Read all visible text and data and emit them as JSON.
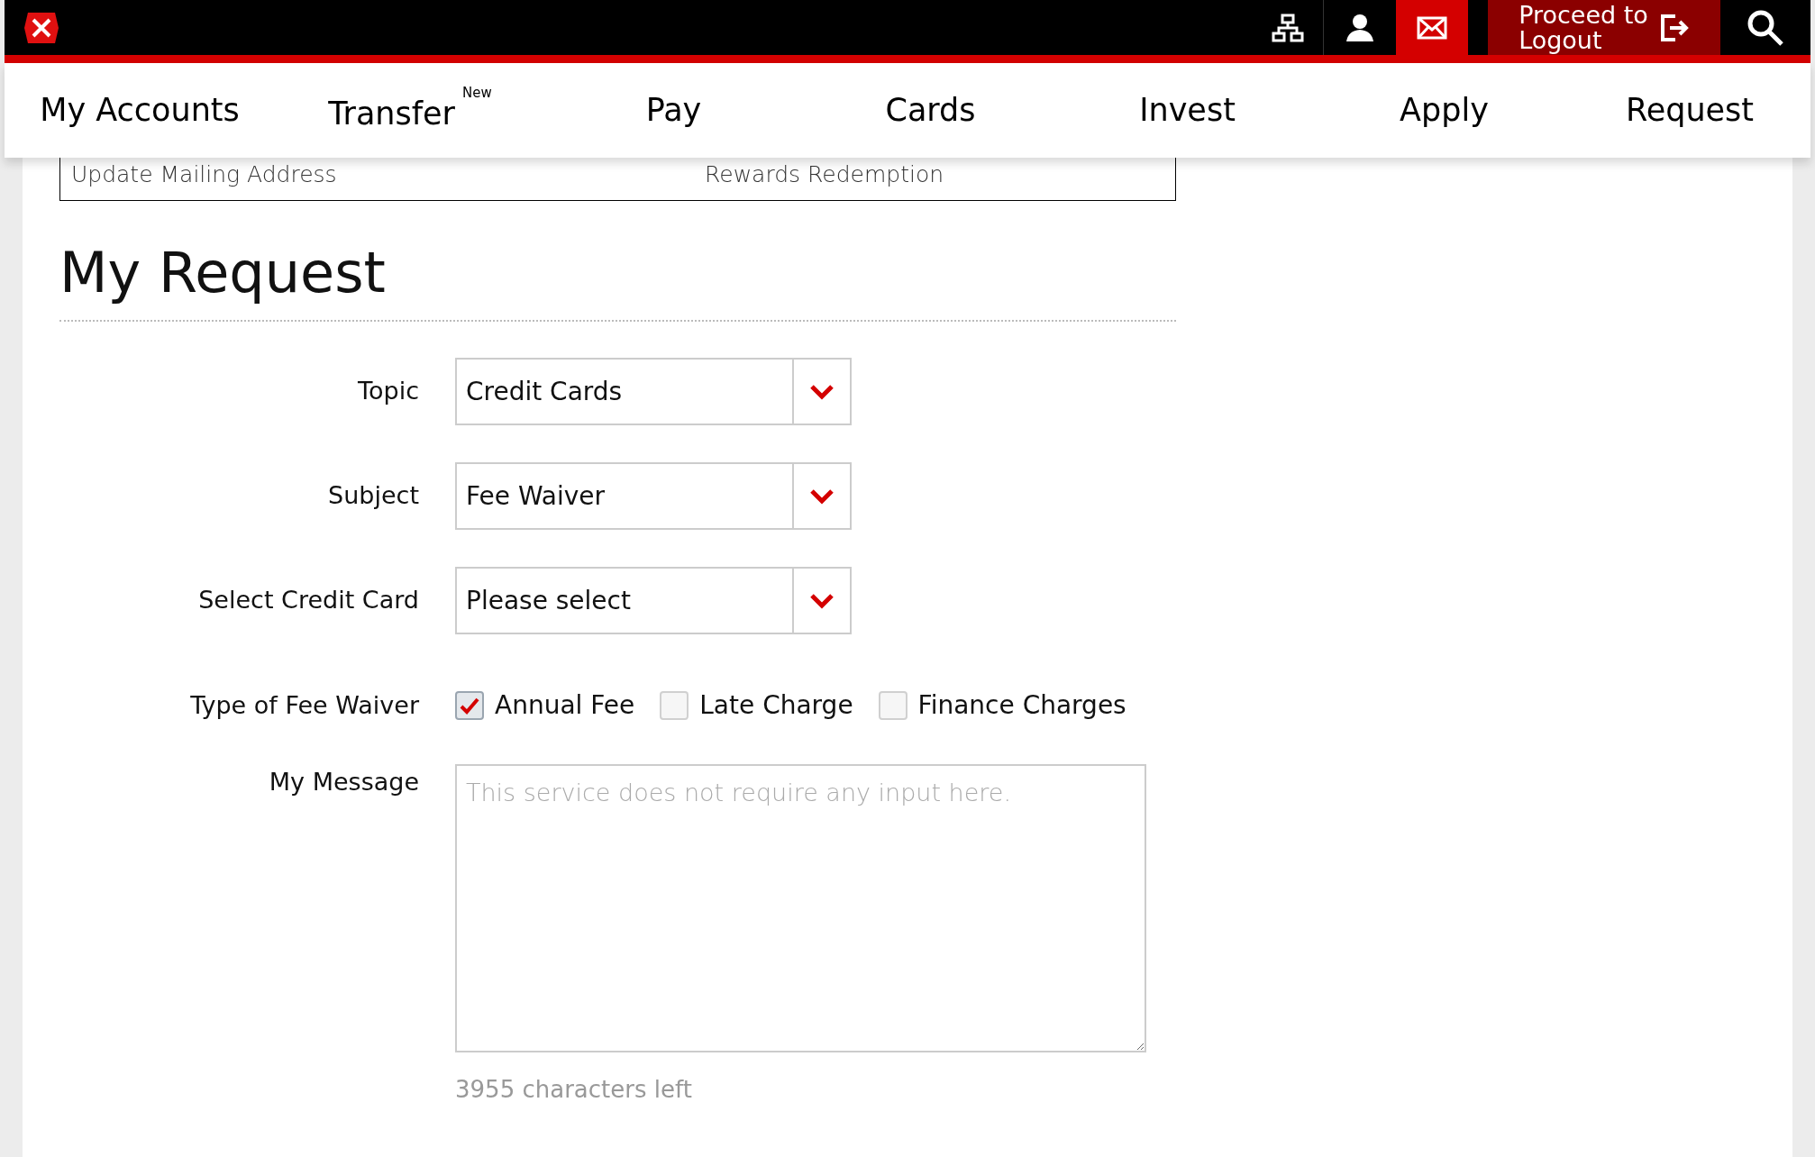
{
  "header": {
    "logout": {
      "line_1": "Proceed to",
      "line_2": "Logout"
    }
  },
  "nav": [
    {
      "label": "My Accounts"
    },
    {
      "label": "Transfer",
      "badge": "New"
    },
    {
      "label": "Pay"
    },
    {
      "label": "Cards"
    },
    {
      "label": "Invest"
    },
    {
      "label": "Apply"
    },
    {
      "label": "Request"
    }
  ],
  "links": [
    "Update Mailing Address",
    "Rewards Redemption"
  ],
  "title": "My Request",
  "form": {
    "selects": [
      {
        "label": "Topic",
        "value": "Credit Cards"
      },
      {
        "label": "Subject",
        "value": "Fee Waiver"
      },
      {
        "label": "Select Credit Card",
        "value": "Please select"
      }
    ],
    "fee_type": {
      "label": "Type of Fee Waiver",
      "options": [
        {
          "label": "Annual Fee",
          "checked": true
        },
        {
          "label": "Late Charge",
          "checked": false
        },
        {
          "label": "Finance Charges",
          "checked": false
        }
      ]
    },
    "message": {
      "label": "My Message",
      "placeholder": "This service does not require any input here.",
      "counter": "3955 characters left"
    }
  }
}
